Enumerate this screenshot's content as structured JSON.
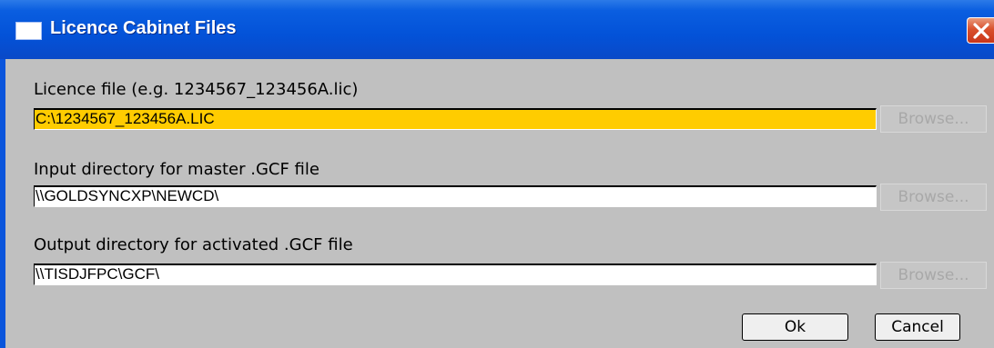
{
  "window": {
    "title": "Licence Cabinet Files",
    "icon": "window-icon",
    "close_icon": "close-icon"
  },
  "fields": [
    {
      "label": "Licence file (e.g. 1234567_123456A.lic)",
      "value": "C:\\1234567_123456A.LIC",
      "browse_label": "Browse...",
      "highlighted": true
    },
    {
      "label": "Input directory for master .GCF file",
      "value": "\\\\GOLDSYNCXP\\NEWCD\\",
      "browse_label": "Browse...",
      "highlighted": false
    },
    {
      "label": "Output directory for activated .GCF file",
      "value": "\\\\TISDJFPC\\GCF\\",
      "browse_label": "Browse...",
      "highlighted": false
    }
  ],
  "buttons": {
    "ok": "Ok",
    "cancel": "Cancel"
  },
  "colors": {
    "titlebar": "#0352d8",
    "active_field": "#ffcc00",
    "dialog_bg": "#c0c0c0",
    "close": "#d9502c"
  }
}
